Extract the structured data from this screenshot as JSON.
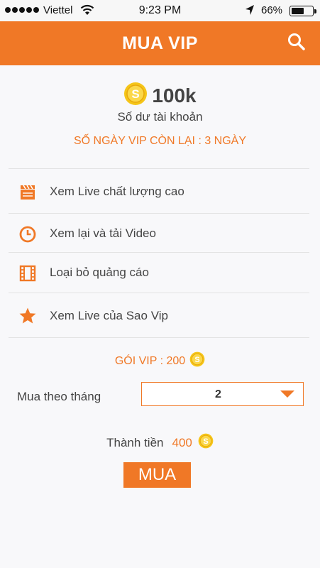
{
  "status_bar": {
    "carrier": "Viettel",
    "time": "9:23 PM",
    "battery_percent": "66%",
    "battery_level": 0.66
  },
  "header": {
    "title": "MUA VIP",
    "search_icon": "search-icon"
  },
  "balance": {
    "amount": "100k",
    "caption": "Số dư tài khoản",
    "days_left": "SỐ NGÀY VIP CÒN LẠI : 3 NGÀY",
    "coin_icon": "coin-icon"
  },
  "features": [
    {
      "label": "Xem Live chất lượng cao",
      "icon": "clapperboard-icon"
    },
    {
      "label": "Xem lại và tải Video",
      "icon": "clock-icon"
    },
    {
      "label": "Loại bỏ quảng cáo",
      "icon": "film-strip-icon"
    },
    {
      "label": "Xem Live của Sao Vip",
      "icon": "star-icon"
    }
  ],
  "vip_package": {
    "label": "GÓI VIP : 200"
  },
  "month": {
    "label": "Mua theo tháng",
    "selected": "2"
  },
  "total": {
    "label": "Thành tiền",
    "value": "400"
  },
  "buy_button": {
    "label": "MUA"
  },
  "colors": {
    "accent": "#f07826",
    "coin": "#f5c518",
    "text": "#444444"
  }
}
